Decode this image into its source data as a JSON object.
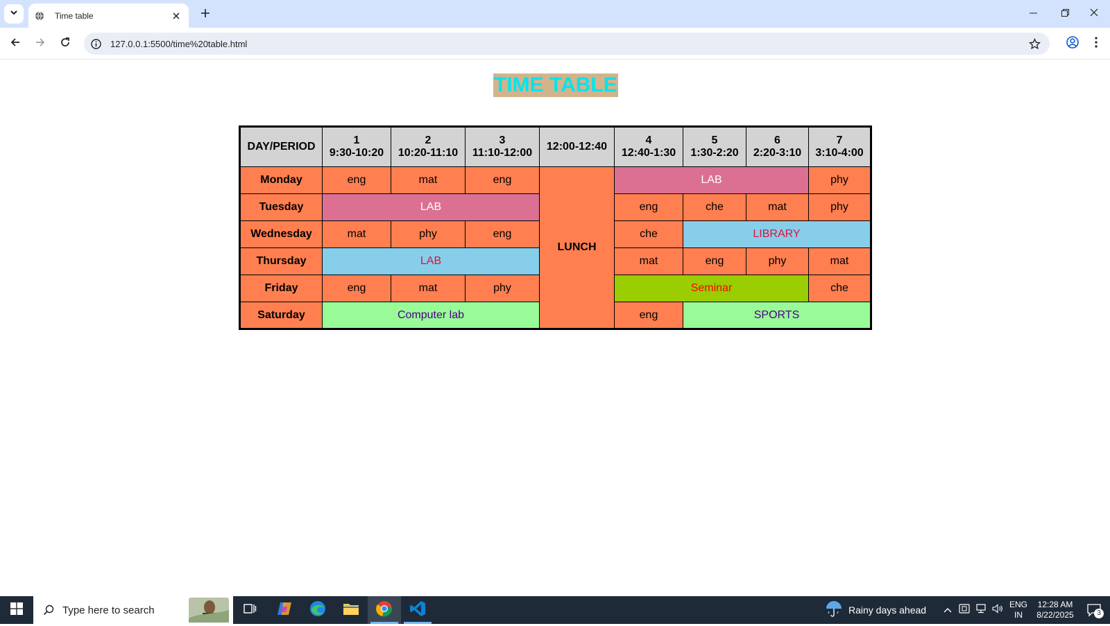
{
  "browser": {
    "tab_title": "Time table",
    "url": "127.0.0.1:5500/time%20table.html",
    "icons": [
      "tab-list-icon",
      "globe-icon",
      "close-icon",
      "plus-icon",
      "minimize-icon",
      "restore-icon",
      "close-window-icon",
      "back-icon",
      "forward-icon",
      "reload-icon",
      "info-icon",
      "star-icon",
      "profile-icon",
      "kebab-menu-icon"
    ]
  },
  "page": {
    "heading": "TIME TABLE",
    "colors": {
      "heading_bg": "#d2b48c",
      "heading_text": "#00e5ee",
      "header_bg": "#d3d3d3",
      "coral": "#ff7f50",
      "lab_pink": "#db7093",
      "sky": "#87ceeb",
      "olive": "#9acd02",
      "mint": "#98fb98"
    },
    "table": {
      "header": {
        "day_period": "DAY/PERIOD",
        "p1_num": "1",
        "p1_time": "9:30-10:20",
        "p2_num": "2",
        "p2_time": "10:20-11:10",
        "p3_num": "3",
        "p3_time": "11:10-12:00",
        "lunch_time": "12:00-12:40",
        "p4_num": "4",
        "p4_time": "12:40-1:30",
        "p5_num": "5",
        "p5_time": "1:30-2:20",
        "p6_num": "6",
        "p6_time": "2:20-3:10",
        "p7_num": "7",
        "p7_time": "3:10-4:00"
      },
      "lunch": "LUNCH",
      "monday": {
        "day": "Monday",
        "p1": "eng",
        "p2": "mat",
        "p3": "eng",
        "p456": "LAB",
        "p7": "phy"
      },
      "tuesday": {
        "day": "Tuesday",
        "p123": "LAB",
        "p4": "eng",
        "p5": "che",
        "p6": "mat",
        "p7": "phy"
      },
      "wednesday": {
        "day": "Wednesday",
        "p1": "mat",
        "p2": "phy",
        "p3": "eng",
        "p4": "che",
        "p567": "LIBRARY"
      },
      "thursday": {
        "day": "Thursday",
        "p123": "LAB",
        "p4": "mat",
        "p5": "eng",
        "p6": "phy",
        "p7": "mat"
      },
      "friday": {
        "day": "Friday",
        "p1": "eng",
        "p2": "mat",
        "p3": "phy",
        "p456": "Seminar",
        "p7": "che"
      },
      "saturday": {
        "day": "Saturday",
        "p123": "Computer lab",
        "p4": "eng",
        "p567": "SPORTS"
      }
    }
  },
  "taskbar": {
    "search_placeholder": "Type here to search",
    "weather": "Rainy days ahead",
    "lang_line1": "ENG",
    "lang_line2": "IN",
    "time": "12:28 AM",
    "date": "8/22/2025",
    "notification_count": "3",
    "icons": [
      "windows-start-icon",
      "search-icon",
      "task-view-icon",
      "copilot-icon",
      "edge-icon",
      "file-explorer-icon",
      "chrome-icon",
      "vscode-icon",
      "weather-icon",
      "chevron-up-icon",
      "meet-icon",
      "network-icon",
      "volume-icon",
      "notification-icon"
    ]
  }
}
